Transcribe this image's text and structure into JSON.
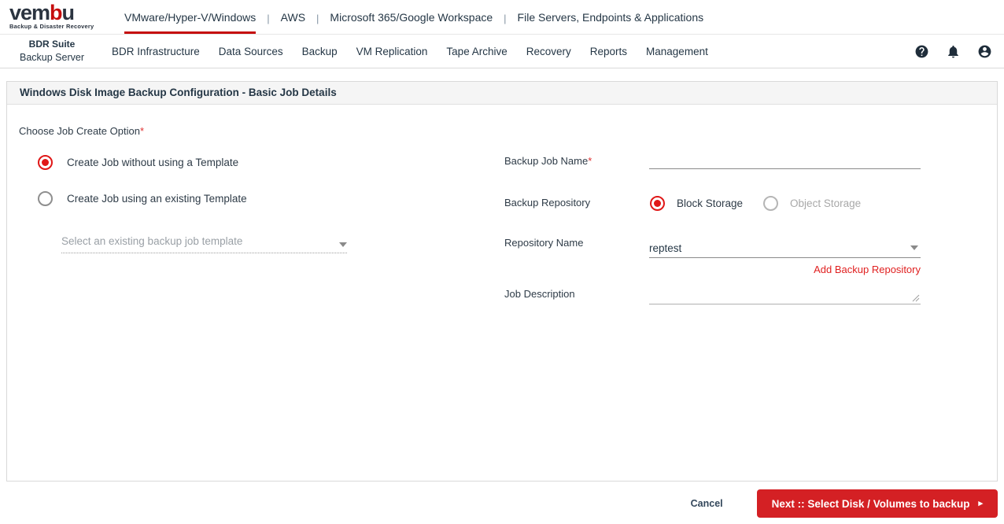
{
  "brand": {
    "logo_text_pre": "vem",
    "logo_text_red": "b",
    "logo_text_post": "u",
    "tagline": "Backup & Disaster Recovery"
  },
  "colors": {
    "accent_red": "#d42024",
    "brand_red": "#c50d0d",
    "dark_navy": "#253746"
  },
  "tab_separator": "|",
  "top_tabs": [
    {
      "label": "VMware/Hyper-V/Windows",
      "active": true
    },
    {
      "label": "AWS",
      "active": false
    },
    {
      "label": "Microsoft 365/Google Workspace",
      "active": false
    },
    {
      "label": "File Servers, Endpoints & Applications",
      "active": false
    }
  ],
  "subnav": {
    "suite_title": "BDR Suite",
    "suite_subtitle": "Backup Server",
    "items": [
      "BDR Infrastructure",
      "Data Sources",
      "Backup",
      "VM Replication",
      "Tape Archive",
      "Recovery",
      "Reports",
      "Management"
    ]
  },
  "header_icons": [
    "help",
    "notifications",
    "account"
  ],
  "page": {
    "title": "Windows Disk Image Backup Configuration - Basic Job Details"
  },
  "form": {
    "section_label": "Choose Job Create Option",
    "required_mark": "*",
    "create_options": [
      {
        "label": "Create Job without using a Template",
        "selected": true
      },
      {
        "label": "Create Job using an existing Template",
        "selected": false
      }
    ],
    "template_select": {
      "placeholder": "Select an existing backup job template",
      "disabled": true
    },
    "backup_job_name": {
      "label": "Backup Job Name",
      "value": ""
    },
    "backup_repository": {
      "label": "Backup Repository",
      "options": [
        {
          "label": "Block Storage",
          "selected": true,
          "disabled": false
        },
        {
          "label": "Object Storage",
          "selected": false,
          "disabled": true
        }
      ]
    },
    "repository_name": {
      "label": "Repository Name",
      "value": "reptest"
    },
    "add_repository_link": "Add Backup Repository",
    "job_description": {
      "label": "Job Description",
      "value": ""
    }
  },
  "footer": {
    "cancel_label": "Cancel",
    "next_label": "Next :: Select Disk / Volumes to backup",
    "next_arrow": "▸"
  }
}
